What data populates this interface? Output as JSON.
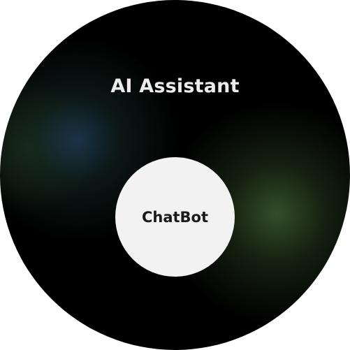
{
  "diagram": {
    "outer": {
      "label": "AI Assistant",
      "fill": "#000000",
      "glow_colors": [
        "#1e3a54",
        "#3e5a30"
      ],
      "text_color": "#ececec"
    },
    "inner": {
      "label": "ChatBot",
      "fill": "#f2f2f2",
      "text_color": "#1a1a1a"
    }
  }
}
